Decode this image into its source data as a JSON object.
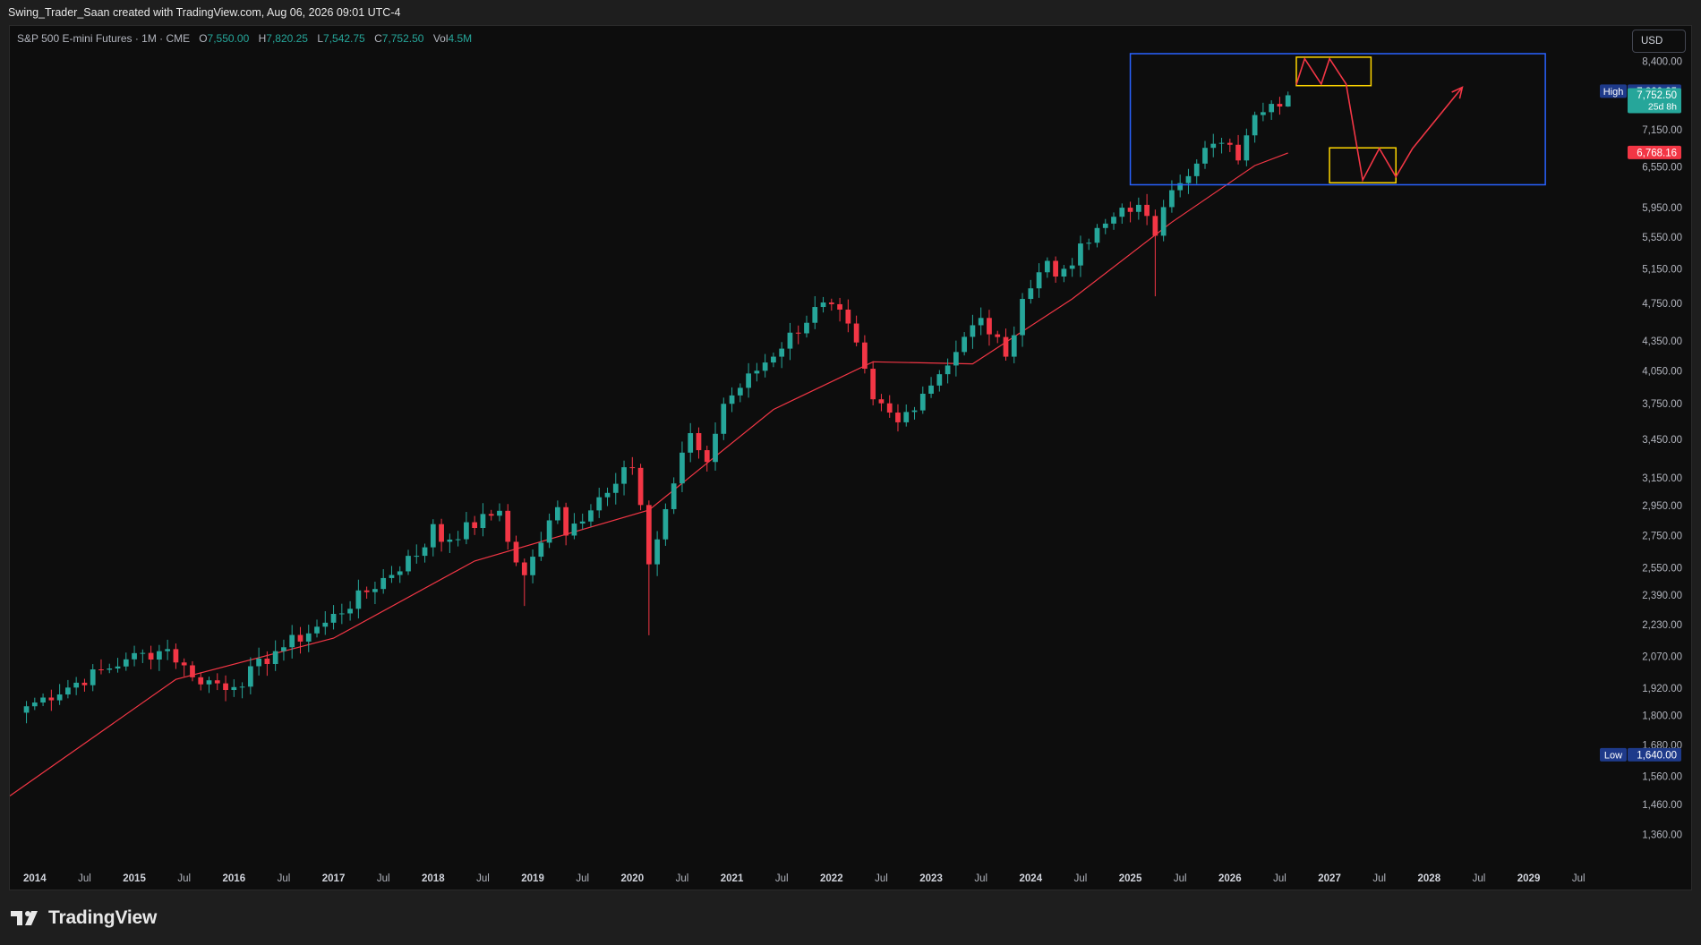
{
  "header": {
    "caption": "Swing_Trader_Saan created with TradingView.com, Aug 06, 2026 09:01 UTC-4"
  },
  "legend": {
    "symbol": "S&P 500 E-mini Futures · 1M · CME",
    "open_label": "O",
    "open": "7,550.00",
    "high_label": "H",
    "high": "7,820.25",
    "low_label": "L",
    "low": "7,542.75",
    "close_label": "C",
    "close": "7,752.50",
    "vol_label": "Vol",
    "vol": "4.5M"
  },
  "currency_button": "USD",
  "footer": {
    "brand": "TradingView"
  },
  "colors": {
    "up": "#26a69a",
    "down": "#f23645",
    "ma": "#f23645",
    "box_blue": "#2962ff",
    "box_yellow": "#ffd600",
    "bg": "#0d0d0d",
    "axis_text": "#b2b5be",
    "high_tag": "#1e3a8a"
  },
  "chart_data": {
    "type": "candlestick",
    "timeframe": "1M",
    "y_scale": "log",
    "ylim": [
      1260,
      8750
    ],
    "x_range": [
      "2013-10",
      "2029-10"
    ],
    "x_tick_labels": [
      {
        "label": "2014",
        "date": "2014-01"
      },
      {
        "label": "Jul",
        "date": "2014-07"
      },
      {
        "label": "2015",
        "date": "2015-01"
      },
      {
        "label": "Jul",
        "date": "2015-07"
      },
      {
        "label": "2016",
        "date": "2016-01"
      },
      {
        "label": "Jul",
        "date": "2016-07"
      },
      {
        "label": "2017",
        "date": "2017-01"
      },
      {
        "label": "Jul",
        "date": "2017-07"
      },
      {
        "label": "2018",
        "date": "2018-01"
      },
      {
        "label": "Jul",
        "date": "2018-07"
      },
      {
        "label": "2019",
        "date": "2019-01"
      },
      {
        "label": "Jul",
        "date": "2019-07"
      },
      {
        "label": "2020",
        "date": "2020-01"
      },
      {
        "label": "Jul",
        "date": "2020-07"
      },
      {
        "label": "2021",
        "date": "2021-01"
      },
      {
        "label": "Jul",
        "date": "2021-07"
      },
      {
        "label": "2022",
        "date": "2022-01"
      },
      {
        "label": "Jul",
        "date": "2022-07"
      },
      {
        "label": "2023",
        "date": "2023-01"
      },
      {
        "label": "Jul",
        "date": "2023-07"
      },
      {
        "label": "2024",
        "date": "2024-01"
      },
      {
        "label": "Jul",
        "date": "2024-07"
      },
      {
        "label": "2025",
        "date": "2025-01"
      },
      {
        "label": "Jul",
        "date": "2025-07"
      },
      {
        "label": "2026",
        "date": "2026-01"
      },
      {
        "label": "Jul",
        "date": "2026-07"
      },
      {
        "label": "2027",
        "date": "2027-01"
      },
      {
        "label": "Jul",
        "date": "2027-07"
      },
      {
        "label": "2028",
        "date": "2028-01"
      },
      {
        "label": "Jul",
        "date": "2028-07"
      },
      {
        "label": "2029",
        "date": "2029-01"
      },
      {
        "label": "Jul",
        "date": "2029-07"
      }
    ],
    "y_tick_labels": [
      "8,400.00",
      "7,150.00",
      "6,550.00",
      "5,950.00",
      "5,550.00",
      "5,150.00",
      "4,750.00",
      "4,350.00",
      "4,050.00",
      "3,750.00",
      "3,450.00",
      "3,150.00",
      "2,950.00",
      "2,750.00",
      "2,550.00",
      "2,390.00",
      "2,230.00",
      "2,070.00",
      "1,920.00",
      "1,800.00",
      "1,680.00",
      "1,560.00",
      "1,460.00",
      "1,360.00"
    ],
    "price_tags": [
      {
        "label": "High",
        "value": 7820.25,
        "text": "7,820.25",
        "kind": "high"
      },
      {
        "label": "",
        "value": 7752.5,
        "text": "7,752.50",
        "sub": "25d 8h",
        "kind": "last"
      },
      {
        "label": "",
        "value": 6768.16,
        "text": "6,768.16",
        "kind": "ma"
      },
      {
        "label": "Low",
        "value": 1640.0,
        "text": "1,640.00",
        "kind": "low"
      }
    ],
    "anchors": [
      {
        "date": "2013-12",
        "close": 1840
      },
      {
        "date": "2014-12",
        "close": 2055
      },
      {
        "date": "2015-05",
        "close": 2105
      },
      {
        "date": "2015-08",
        "close": 1970
      },
      {
        "date": "2016-01",
        "close": 1925
      },
      {
        "date": "2016-06",
        "close": 2095
      },
      {
        "date": "2016-12",
        "close": 2240
      },
      {
        "date": "2017-12",
        "close": 2675
      },
      {
        "date": "2018-01",
        "close": 2825
      },
      {
        "date": "2018-02",
        "close": 2710
      },
      {
        "date": "2018-09",
        "close": 2915
      },
      {
        "date": "2018-10",
        "close": 2710
      },
      {
        "date": "2018-12",
        "close": 2505
      },
      {
        "date": "2019-04",
        "close": 2940
      },
      {
        "date": "2019-05",
        "close": 2750
      },
      {
        "date": "2019-12",
        "close": 3230
      },
      {
        "date": "2020-01",
        "close": 3225
      },
      {
        "date": "2020-02",
        "close": 2955
      },
      {
        "date": "2020-03",
        "close": 2570
      },
      {
        "date": "2020-08",
        "close": 3500
      },
      {
        "date": "2020-10",
        "close": 3270
      },
      {
        "date": "2020-12",
        "close": 3750
      },
      {
        "date": "2021-12",
        "close": 4760
      },
      {
        "date": "2022-03",
        "close": 4530
      },
      {
        "date": "2022-06",
        "close": 3790
      },
      {
        "date": "2022-09",
        "close": 3590
      },
      {
        "date": "2022-12",
        "close": 3840
      },
      {
        "date": "2023-07",
        "close": 4590
      },
      {
        "date": "2023-10",
        "close": 4190
      },
      {
        "date": "2023-12",
        "close": 4800
      },
      {
        "date": "2024-03",
        "close": 5250
      },
      {
        "date": "2024-04",
        "close": 5060
      },
      {
        "date": "2024-12",
        "close": 5950
      },
      {
        "date": "2025-02",
        "close": 5990
      },
      {
        "date": "2025-04",
        "close": 5570
      },
      {
        "date": "2025-06",
        "close": 6200
      },
      {
        "date": "2025-10",
        "close": 6850
      },
      {
        "date": "2026-01",
        "close": 6900
      },
      {
        "date": "2026-02",
        "close": 6650
      },
      {
        "date": "2026-04",
        "close": 7400
      },
      {
        "date": "2026-05",
        "close": 7450
      },
      {
        "date": "2026-07",
        "close": 7550
      },
      {
        "date": "2026-08",
        "close": 7752.5
      }
    ],
    "moving_average": {
      "name": "",
      "points": [
        {
          "date": "2013-10",
          "value": 1490
        },
        {
          "date": "2015-06",
          "value": 1960
        },
        {
          "date": "2017-01",
          "value": 2160
        },
        {
          "date": "2018-06",
          "value": 2590
        },
        {
          "date": "2020-03",
          "value": 2920
        },
        {
          "date": "2021-06",
          "value": 3700
        },
        {
          "date": "2022-06",
          "value": 4140
        },
        {
          "date": "2023-06",
          "value": 4120
        },
        {
          "date": "2024-06",
          "value": 4800
        },
        {
          "date": "2025-06",
          "value": 5750
        },
        {
          "date": "2026-04",
          "value": 6570
        },
        {
          "date": "2026-08",
          "value": 6768.16
        }
      ]
    },
    "drawings": {
      "blue_box": {
        "from": "2025-01",
        "to": "2029-03",
        "top": 8550,
        "bottom": 6280
      },
      "yellow_box_top": {
        "from": "2026-09",
        "to": "2027-06",
        "top": 8480,
        "bottom": 7930
      },
      "yellow_box_bottom": {
        "from": "2027-01",
        "to": "2027-09",
        "top": 6850,
        "bottom": 6310
      },
      "path": [
        {
          "date": "2026-09",
          "value": 7950
        },
        {
          "date": "2026-10",
          "value": 8450
        },
        {
          "date": "2026-12",
          "value": 7960
        },
        {
          "date": "2027-01",
          "value": 8450
        },
        {
          "date": "2027-03",
          "value": 7960
        },
        {
          "date": "2027-05",
          "value": 6350
        },
        {
          "date": "2027-07",
          "value": 6840
        },
        {
          "date": "2027-09",
          "value": 6400
        },
        {
          "date": "2027-11",
          "value": 6840
        },
        {
          "date": "2028-05",
          "value": 7900
        }
      ]
    }
  }
}
